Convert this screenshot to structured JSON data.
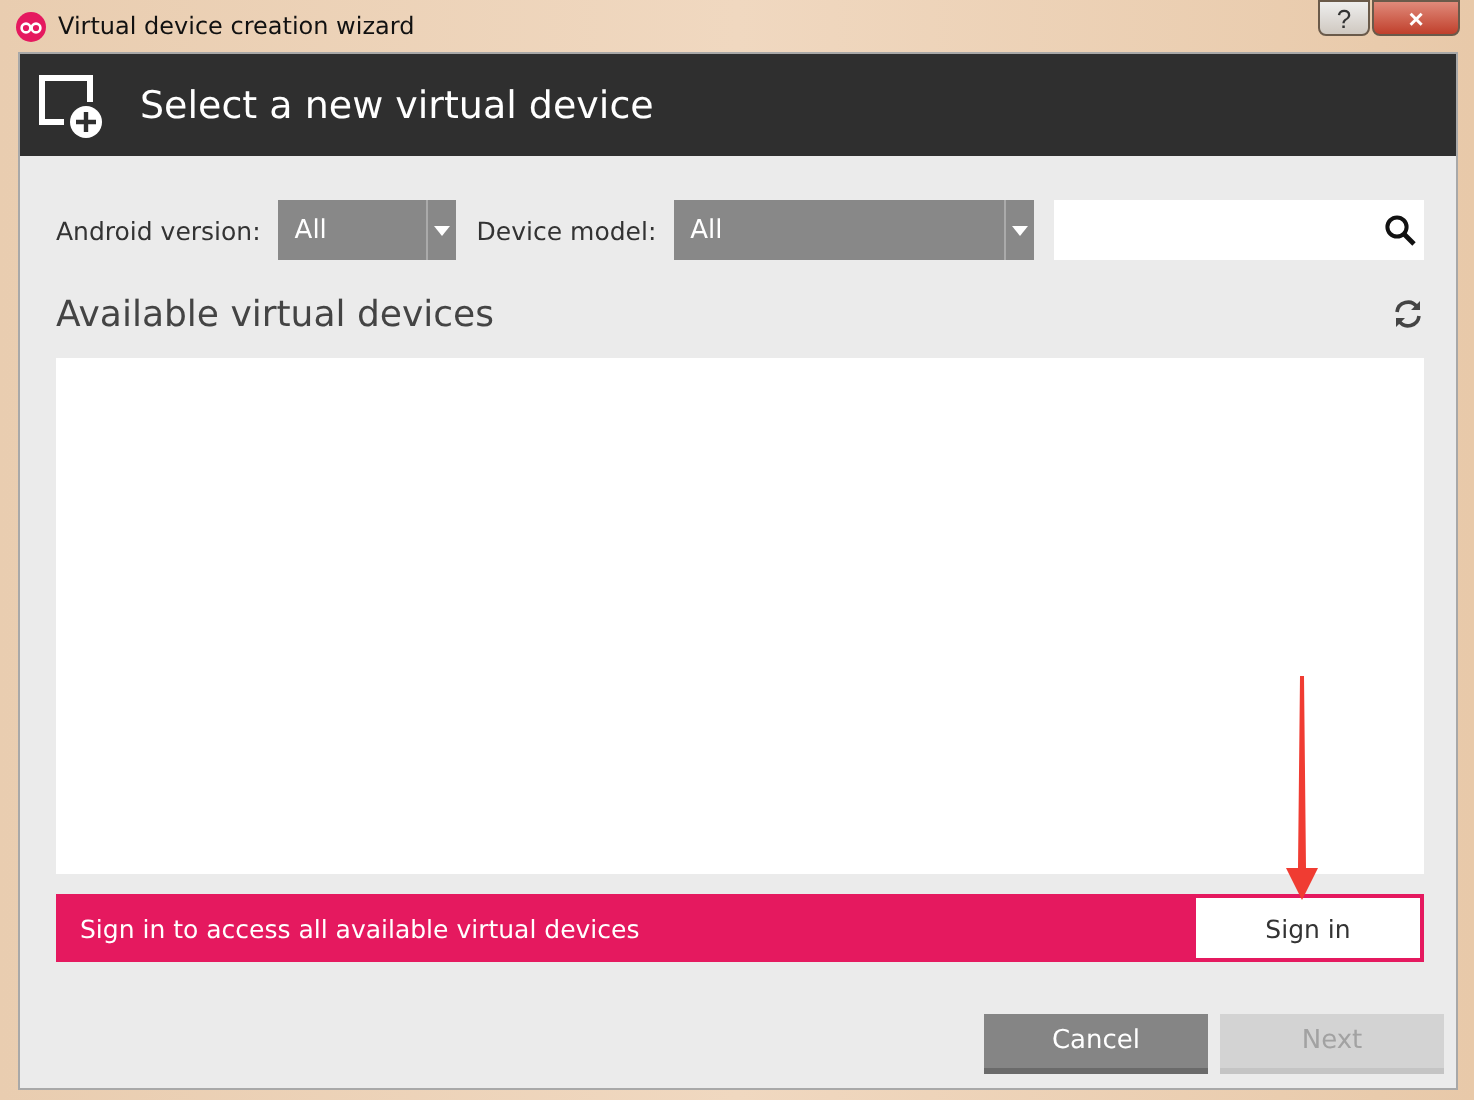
{
  "window": {
    "title": "Virtual device creation wizard",
    "help": "?",
    "close": "×"
  },
  "header": {
    "title": "Select a new virtual device"
  },
  "filters": [
    {
      "label": "Android version:",
      "value": "All"
    },
    {
      "label": "Device model:",
      "value": "All"
    }
  ],
  "list": {
    "title": "Available virtual devices"
  },
  "banner": {
    "message": "Sign in to access all available virtual devices",
    "button": "Sign in"
  },
  "buttons": [
    {
      "label": "Cancel",
      "disabled": false
    },
    {
      "label": "Next",
      "disabled": true
    }
  ]
}
